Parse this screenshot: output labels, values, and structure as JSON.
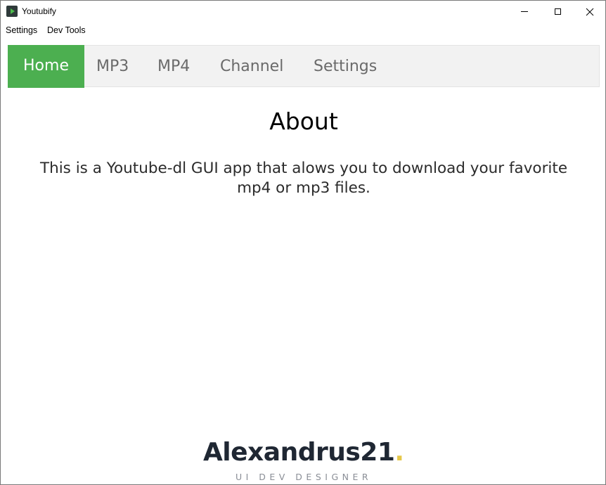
{
  "window": {
    "title": "Youtubify",
    "app_icon": "play-icon"
  },
  "menu": {
    "settings": "Settings",
    "dev_tools": "Dev Tools"
  },
  "tabs": [
    {
      "label": "Home",
      "active": true
    },
    {
      "label": "MP3",
      "active": false
    },
    {
      "label": "MP4",
      "active": false
    },
    {
      "label": "Channel",
      "active": false
    },
    {
      "label": "Settings",
      "active": false
    }
  ],
  "content": {
    "heading": "About",
    "description": "This is a Youtube-dl GUI app that alows you to download your favorite mp4 or mp3 files."
  },
  "footer": {
    "brand": "Alexandrus21",
    "brand_dot": ".",
    "tagline": "UI DEV DESIGNER"
  },
  "colors": {
    "active_tab": "#4caf50",
    "nav_background": "#f2f2f2",
    "brand_text": "#1f2733",
    "brand_dot": "#e6c84a"
  }
}
